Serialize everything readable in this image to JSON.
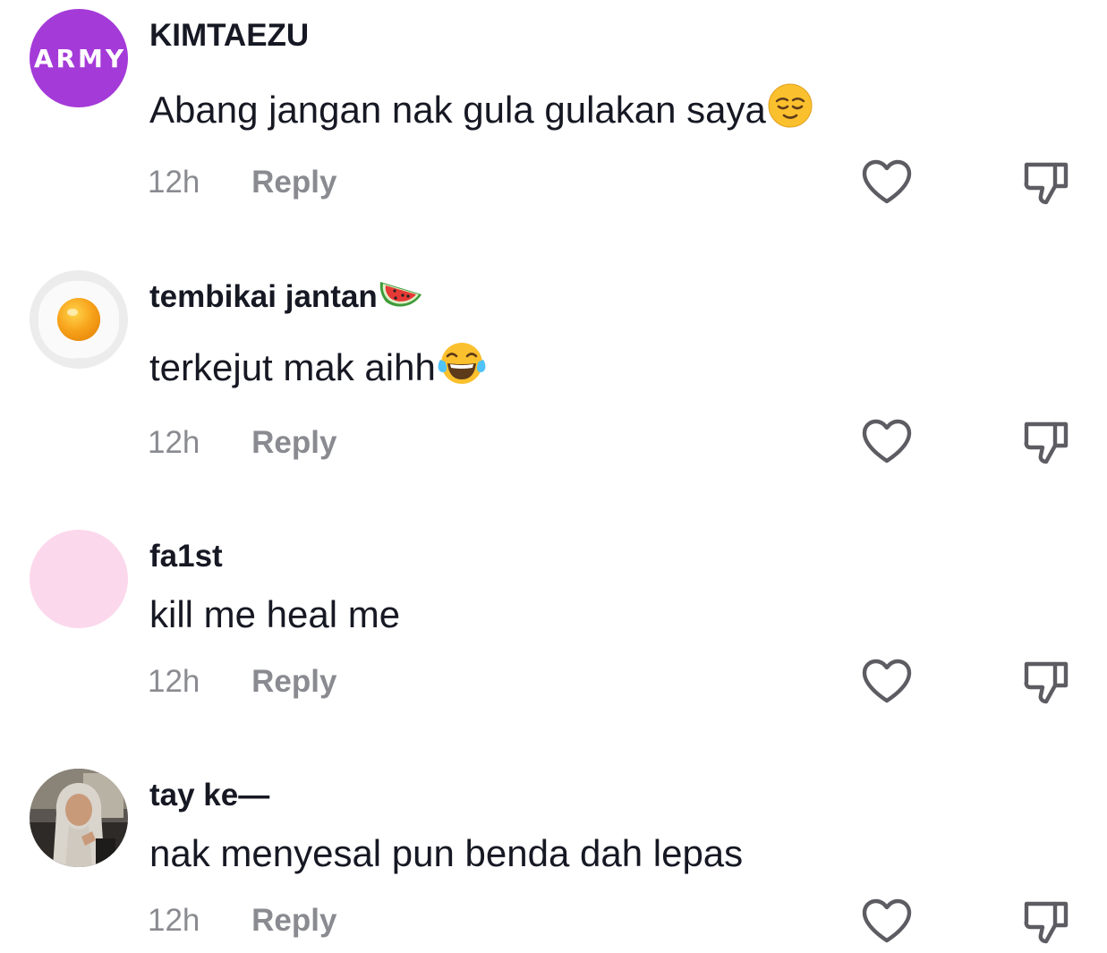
{
  "comments": [
    {
      "username": "KIMTAEZU",
      "avatar_text": "ARMY",
      "text": "Abang jangan nak gula gulakan saya",
      "text_emoji": "relieved-face",
      "time": "12h",
      "reply_label": "Reply"
    },
    {
      "username": "tembikai jantan",
      "username_emoji": "watermelon",
      "avatar": "fried-egg",
      "text": "terkejut mak aihh",
      "text_emoji": "face-with-tears-of-joy",
      "time": "12h",
      "reply_label": "Reply"
    },
    {
      "username": "fa1st",
      "avatar": "pink-circle",
      "text": "kill me heal me",
      "time": "12h",
      "reply_label": "Reply"
    },
    {
      "username": "tay ke—",
      "avatar": "profile-photo",
      "text": "nak menyesal pun benda dah lepas",
      "time": "12h",
      "reply_label": "Reply"
    }
  ],
  "colors": {
    "text": "#161823",
    "muted": "#8a8b91",
    "icon": "#5c5c62",
    "army_avatar": "#a43ad8",
    "pink_avatar": "#fcd8ec"
  }
}
